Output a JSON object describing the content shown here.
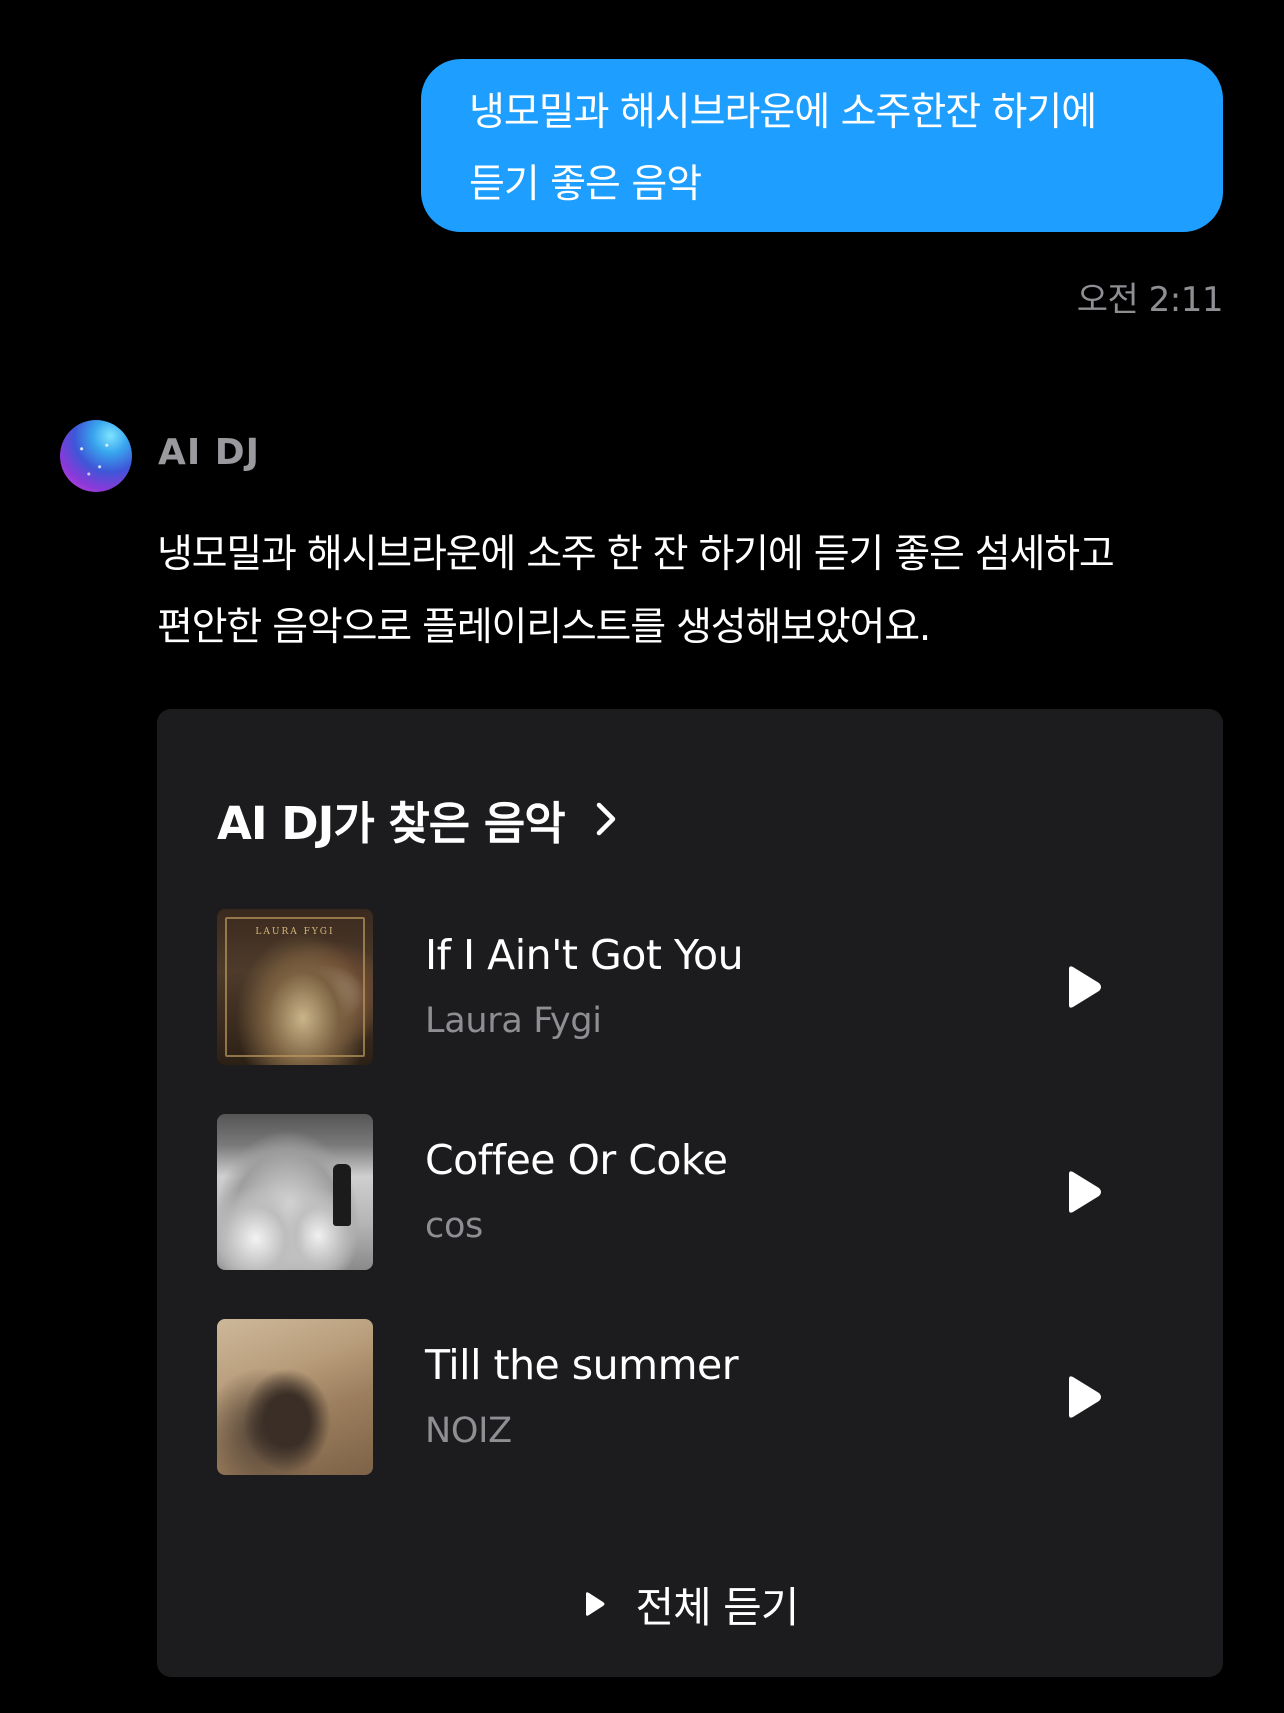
{
  "user_message": {
    "line1": "냉모밀과 해시브라운에 소주한잔 하기에",
    "line2": "듣기 좋은 음악",
    "time": "오전 2:11"
  },
  "ai": {
    "name": "AI DJ",
    "line1": "냉모밀과 해시브라운에 소주 한 잔 하기에 듣기 좋은 섬세하고",
    "line2": "편안한 음악으로 플레이리스트를 생성해보았어요."
  },
  "card": {
    "title": "AI DJ가 찾은 음악",
    "tracks": [
      {
        "title": "If I Ain't Got You",
        "artist": "Laura Fygi",
        "art_label": "LAURA FYGI"
      },
      {
        "title": "Coffee Or Coke",
        "artist": "cos"
      },
      {
        "title": "Till the summer",
        "artist": "NOIZ"
      }
    ],
    "play_all_label": "전체 듣기"
  },
  "colors": {
    "bubble": "#1e9fff",
    "card": "#1c1c1e",
    "secondary_text": "#8e8e93"
  }
}
